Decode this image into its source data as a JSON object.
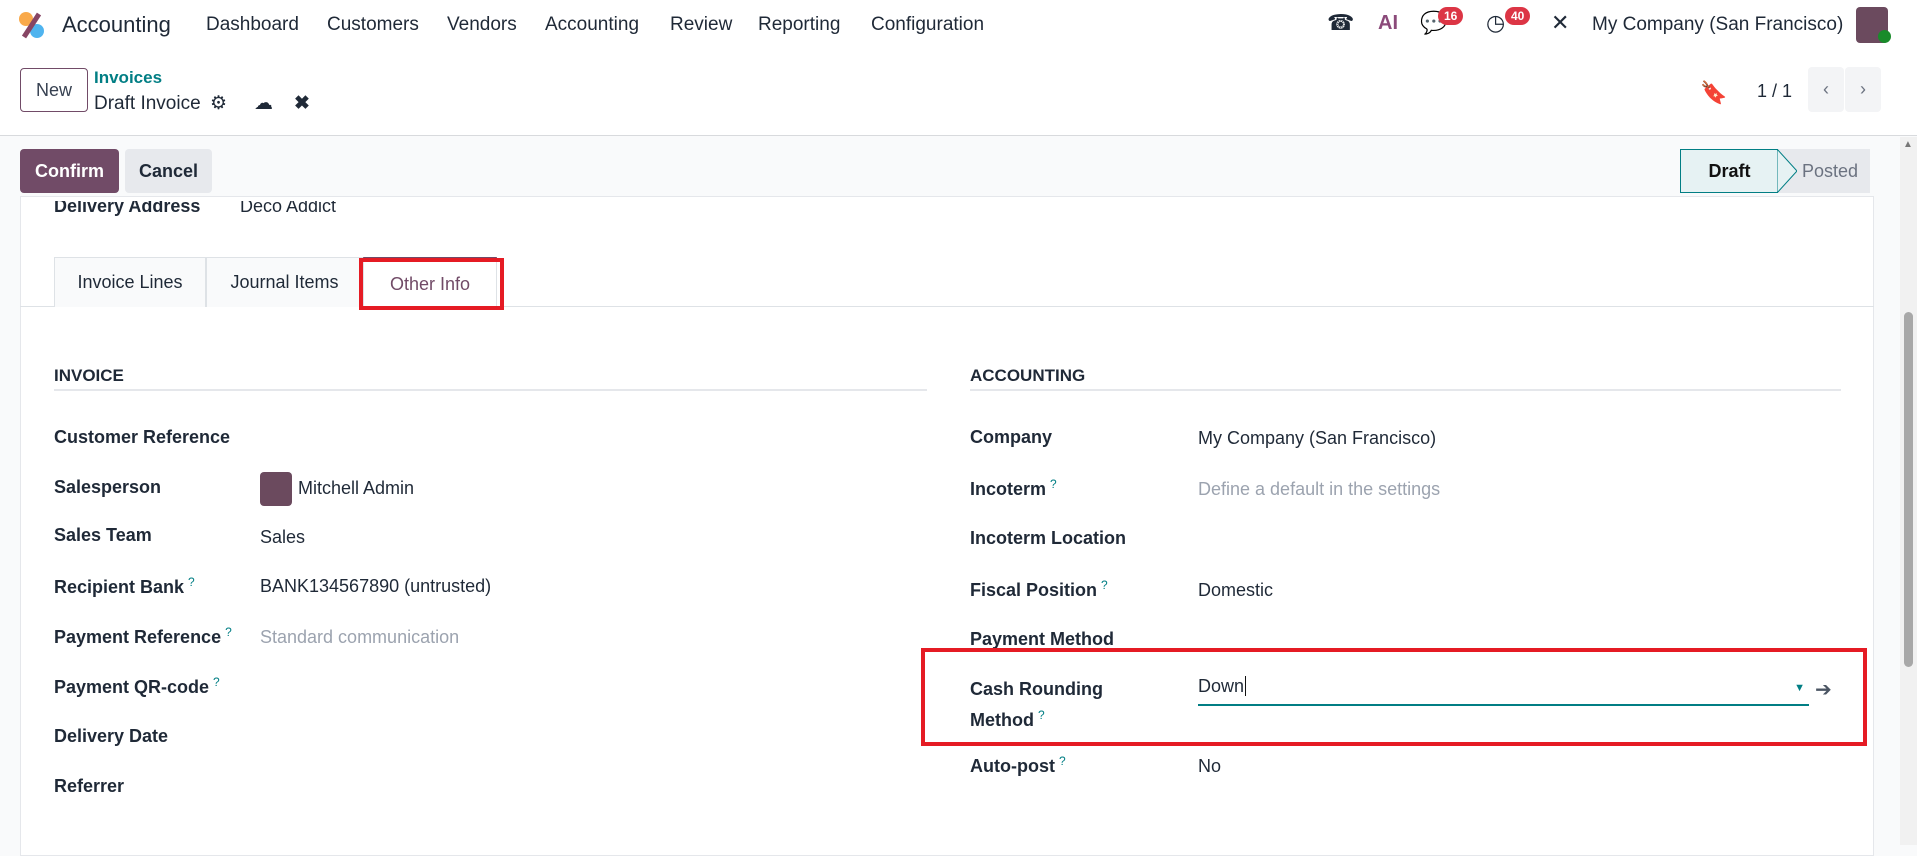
{
  "navbar": {
    "app_name": "Accounting",
    "menu": [
      "Dashboard",
      "Customers",
      "Vendors",
      "Accounting",
      "Review",
      "Reporting",
      "Configuration"
    ],
    "messages_badge": "16",
    "activities_badge": "40",
    "ai_label": "AI",
    "company": "My Company (San Francisco)"
  },
  "control": {
    "new_label": "New",
    "breadcrumb_parent": "Invoices",
    "breadcrumb_current": "Draft Invoice",
    "pager": "1 / 1"
  },
  "actions": {
    "confirm": "Confirm",
    "cancel": "Cancel",
    "status": [
      "Draft",
      "Posted"
    ],
    "active_status": "Draft"
  },
  "form": {
    "delivery_label": "Delivery Address",
    "delivery_value": "Deco Addict",
    "tabs": [
      "Invoice Lines",
      "Journal Items",
      "Other Info"
    ],
    "active_tab": "Other Info",
    "invoice": {
      "title": "INVOICE",
      "fields": [
        {
          "label": "Customer Reference",
          "value": ""
        },
        {
          "label": "Salesperson",
          "value": "Mitchell Admin"
        },
        {
          "label": "Sales Team",
          "value": "Sales"
        },
        {
          "label": "Recipient Bank",
          "value": "BANK134567890 (untrusted)",
          "help": "?"
        },
        {
          "label": "Payment Reference",
          "value": "Standard communication",
          "help": "?"
        },
        {
          "label": "Payment QR-code",
          "value": "",
          "help": "?"
        },
        {
          "label": "Delivery Date",
          "value": ""
        },
        {
          "label": "Referrer",
          "value": ""
        }
      ]
    },
    "accounting": {
      "title": "ACCOUNTING",
      "fields": [
        {
          "label": "Company",
          "value": "My Company (San Francisco)"
        },
        {
          "label": "Incoterm",
          "value": "Define a default in the settings",
          "help": "?"
        },
        {
          "label": "Incoterm Location",
          "value": ""
        },
        {
          "label": "Fiscal Position",
          "value": "Domestic",
          "help": "?"
        },
        {
          "label": "Payment Method",
          "value": ""
        },
        {
          "label_1": "Cash Rounding",
          "label_2": "Method",
          "value": "Down",
          "help": "?"
        },
        {
          "label": "Auto-post",
          "value": "No",
          "help": "?"
        }
      ]
    }
  },
  "colors": {
    "primary": "#714b67",
    "accent": "#017e84",
    "highlight": "#e51b24"
  }
}
